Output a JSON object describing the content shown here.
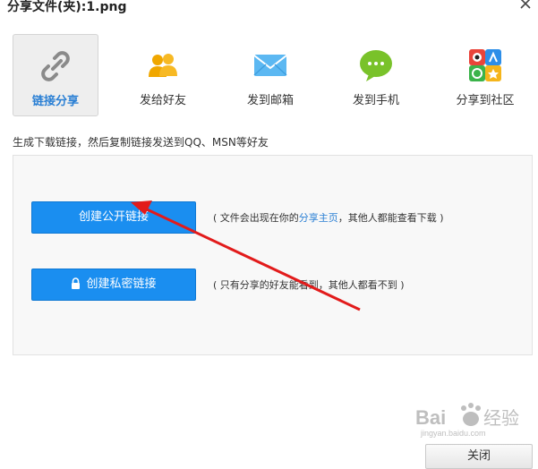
{
  "window": {
    "title": "分享文件(夹):1.png"
  },
  "tabs": [
    {
      "label": "链接分享",
      "icon": "link-icon",
      "active": true
    },
    {
      "label": "发给好友",
      "icon": "friends-icon",
      "active": false
    },
    {
      "label": "发到邮箱",
      "icon": "mail-icon",
      "active": false
    },
    {
      "label": "发到手机",
      "icon": "chat-bubble-icon",
      "active": false
    },
    {
      "label": "分享到社区",
      "icon": "community-icon",
      "active": false
    }
  ],
  "description": "生成下载链接，然后复制链接发送到QQ、MSN等好友",
  "public_link": {
    "button_label": "创建公开链接",
    "note_prefix": "( 文件会出现在你的",
    "note_link": "分享主页",
    "note_suffix": "，其他人都能查看下载 )"
  },
  "private_link": {
    "button_label": "创建私密链接",
    "note": "( 只有分享的好友能看到，其他人都看不到 )"
  },
  "footer": {
    "close_label": "关闭"
  },
  "watermark": {
    "text": "Bai 经验",
    "subtext": "jingyan.baidu.com"
  },
  "colors": {
    "accent": "#1a8ef0",
    "annotation_arrow": "#e21b1b"
  }
}
